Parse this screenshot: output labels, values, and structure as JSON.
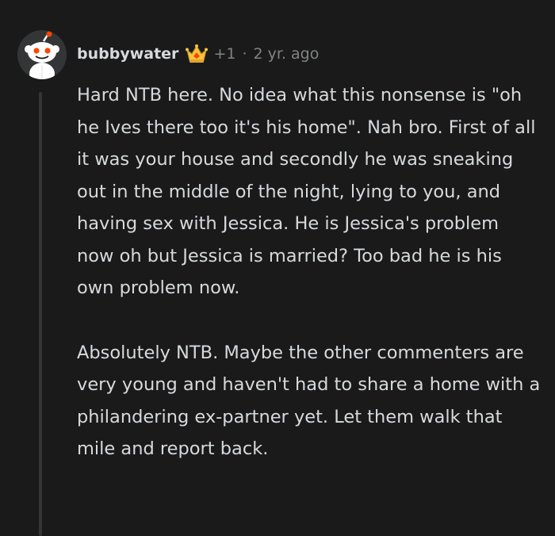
{
  "comment": {
    "username": "bubbywater",
    "award_count": "+1",
    "separator": "·",
    "timestamp": "2 yr. ago",
    "paragraphs": [
      "Hard NTB here. No idea what this nonsense is \"oh he Ives there too it's his home\". Nah bro. First of all it was your house and secondly he was sneaking out in the middle of the night, lying to you, and having sex with Jessica. He is Jessica's problem now oh but Jessica is married? Too bad he is his own problem now.",
      "Absolutely NTB. Maybe the other commenters are very young and haven't had to share a home with a philandering ex-partner yet. Let them walk that mile and report back."
    ]
  },
  "icons": {
    "avatar": "snoo-avatar-icon",
    "award": "crown-award-icon"
  },
  "colors": {
    "background": "#1a1a1b",
    "text": "#d7dadc",
    "meta": "#818384",
    "thread_line": "#343536",
    "award_gold": "#f5c542",
    "snoo_red": "#ff4500"
  }
}
